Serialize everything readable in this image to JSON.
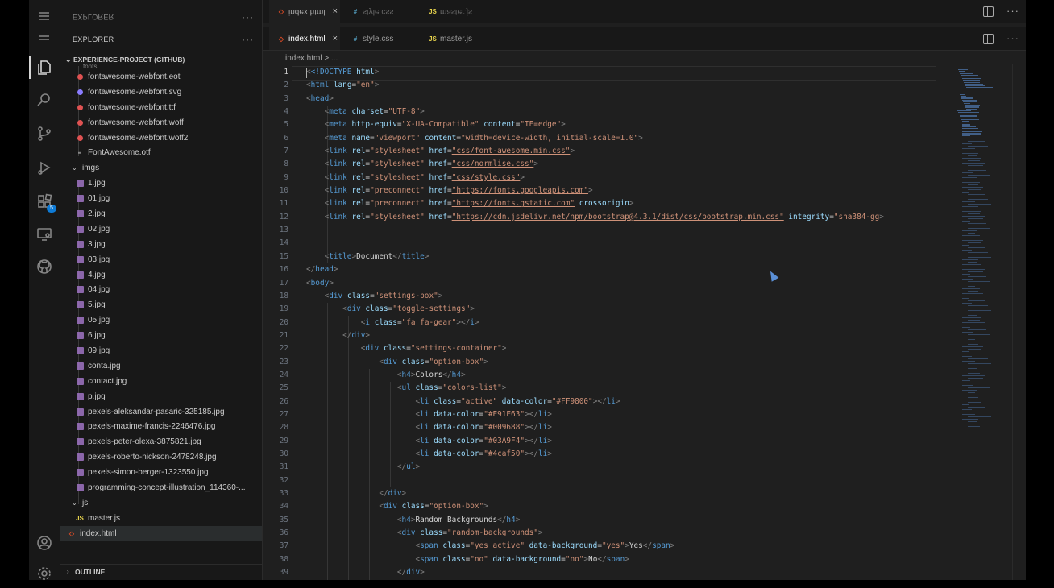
{
  "explorer": {
    "title_top": "EXPLORER",
    "title": "EXPLORER",
    "more": "···",
    "project": "EXPERIENCE-PROJECT (GITHUB)",
    "partial_folder": "fonts",
    "font_files": [
      "fontawesome-webfont.eot",
      "fontawesome-webfont.svg",
      "fontawesome-webfont.ttf",
      "fontawesome-webfont.woff",
      "fontawesome-webfont.woff2",
      "FontAwesome.otf"
    ],
    "imgs_folder": "imgs",
    "img_files": [
      "1.jpg",
      "01.jpg",
      "2.jpg",
      "02.jpg",
      "3.jpg",
      "03.jpg",
      "4.jpg",
      "04.jpg",
      "5.jpg",
      "05.jpg",
      "6.jpg",
      "09.jpg",
      "conta.jpg",
      "contact.jpg",
      "p.jpg",
      "pexels-aleksandar-pasaric-325185.jpg",
      "pexels-maxime-francis-2246476.jpg",
      "pexels-peter-olexa-3875821.jpg",
      "pexels-roberto-nickson-2478248.jpg",
      "pexels-simon-berger-1323550.jpg",
      "programming-concept-illustration_114360-..."
    ],
    "js_folder": "js",
    "js_files": [
      "master.js"
    ],
    "root_files": [
      "index.html"
    ],
    "outline": "OUTLINE"
  },
  "activity": {
    "badge": "5",
    "icons": [
      "files-icon",
      "search-icon",
      "source-control-icon",
      "run-debug-icon",
      "extensions-icon",
      "remote-explorer-icon",
      "github-icon",
      "account-icon",
      "settings-gear-icon"
    ]
  },
  "tabs": {
    "mirrored": [
      "index.html",
      "style.css",
      "master.js"
    ],
    "open": [
      {
        "label": "index.html",
        "icon": "html-icon",
        "active": true
      },
      {
        "label": "style.css",
        "icon": "css-icon",
        "active": false
      },
      {
        "label": "master.js",
        "icon": "js-icon",
        "active": false
      }
    ],
    "close": "×"
  },
  "breadcrumb": "index.html > ...",
  "code_lines": [
    "1",
    "2",
    "3",
    "4",
    "5",
    "6",
    "7",
    "8",
    "9",
    "10",
    "11",
    "12",
    "13",
    "14",
    "15",
    "16",
    "17",
    "18",
    "19",
    "20",
    "21",
    "22",
    "23",
    "24",
    "25",
    "26",
    "27",
    "28",
    "29",
    "30",
    "31",
    "32",
    "33",
    "34",
    "35",
    "36",
    "37",
    "38",
    "39"
  ],
  "code": {
    "l1_doctype": "<!DOCTYPE",
    "l1_html": "html",
    "l2_lang": "\"en\"",
    "l4_charset": "\"UTF-8\"",
    "l5_equiv": "\"X-UA-Compatible\"",
    "l5_content": "\"IE=edge\"",
    "l6_name": "\"viewport\"",
    "l6_content": "\"width=device-width, initial-scale=1.0\"",
    "l7_href": "\"css/font-awesome.min.css\"",
    "l8_href": "\"css/normlise.css\"",
    "l9_href": "\"css/style.css\"",
    "l10_href": "\"https://fonts.googleapis.com\"",
    "l11_href": "\"https://fonts.gstatic.com\"",
    "l11_attr": "crossorigin",
    "l12_href": "\"https://cdn.jsdelivr.net/npm/bootstrap@4.3.1/dist/css/bootstrap.min.css\"",
    "l12_int": "\"sha384-gg",
    "l15_title": "Document",
    "l18_class": "\"settings-box\"",
    "l19_class": "\"toggle-settings\"",
    "l20_class": "\"fa fa-gear\"",
    "l22_class": "\"settings-container\"",
    "l23_class": "\"option-box\"",
    "l24_text": "Colors",
    "l25_class": "\"colors-list\"",
    "l26_class": "\"active\"",
    "l26_color": "\"#FF9800\"",
    "l27_color": "\"#E91E63\"",
    "l28_color": "\"#009688\"",
    "l29_color": "\"#03A9F4\"",
    "l30_color": "\"#4caf50\"",
    "l34_class": "\"option-box\"",
    "l35_text": "Random Backgrounds",
    "l36_class": "\"random-backgrounds\"",
    "l37_class": "\"yes active\"",
    "l37_bg": "\"yes\"",
    "l37_text": "Yes",
    "l38_class": "\"no\"",
    "l38_bg": "\"no\"",
    "l38_text": "No"
  }
}
